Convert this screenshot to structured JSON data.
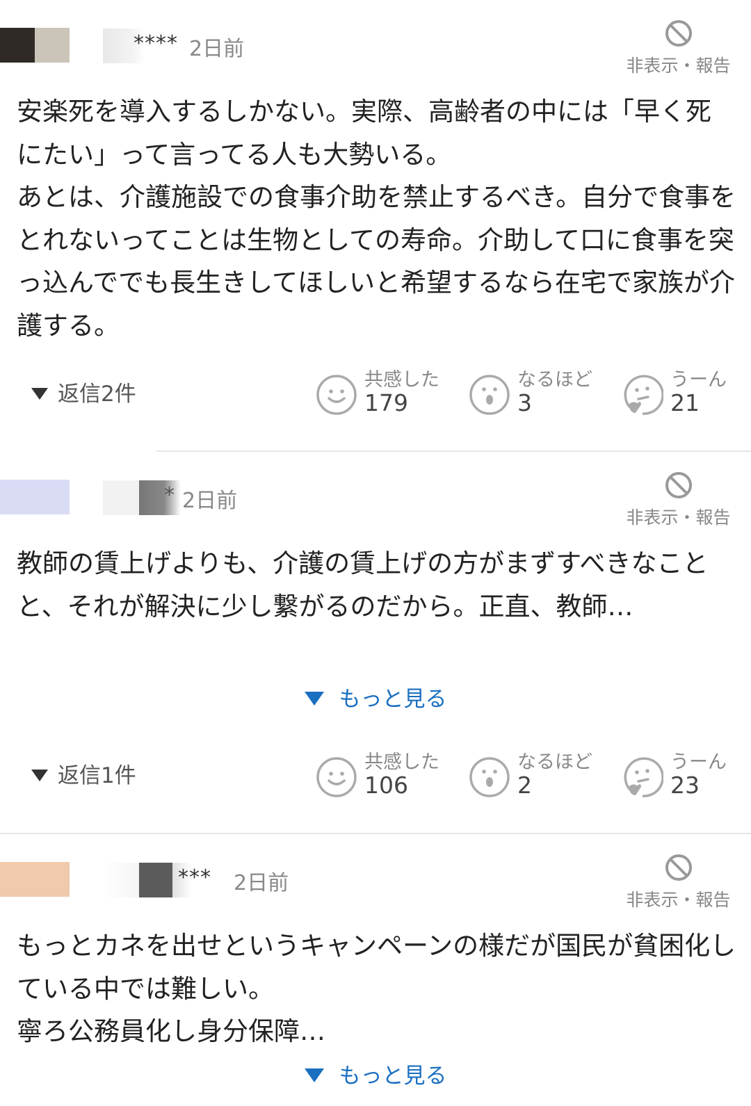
{
  "labels": {
    "hide_report": "非表示・報告",
    "more": "もっと見る"
  },
  "reaction_labels": {
    "agree": "共感した",
    "insight": "なるほど",
    "hmm": "うーん"
  },
  "colors": {
    "link": "#1a6fc0",
    "meta": "#888888",
    "text": "#222222",
    "divider": "#e6e6e6"
  },
  "comments": [
    {
      "username_visible": "****",
      "time": "2日前",
      "body": [
        "安楽死を導入するしかない。実際、高齢者の中には「早く死にたい」って言ってる人も大勢いる。",
        "あとは、介護施設での食事介助を禁止するべき。自分で食事をとれないってことは生物としての寿命。介助して口に食事を突っ込んででも長生きしてほしいと希望するなら在宅で家族が介護する。"
      ],
      "replies": "返信2件",
      "reactions": {
        "agree": "179",
        "insight": "3",
        "hmm": "21"
      }
    },
    {
      "username_visible": "*",
      "time": "2日前",
      "body": [
        "教師の賃上げよりも、介護の賃上げの方がまずすべきなことと、それが解決に少し繋がるのだから。正直、教師…"
      ],
      "replies": "返信1件",
      "reactions": {
        "agree": "106",
        "insight": "2",
        "hmm": "23"
      }
    },
    {
      "username_visible": "***",
      "time": "2日前",
      "body": [
        "もっとカネを出せというキャンペーンの様だが国民が貧困化している中では難しい。",
        "寧ろ公務員化し身分保障…"
      ]
    }
  ]
}
